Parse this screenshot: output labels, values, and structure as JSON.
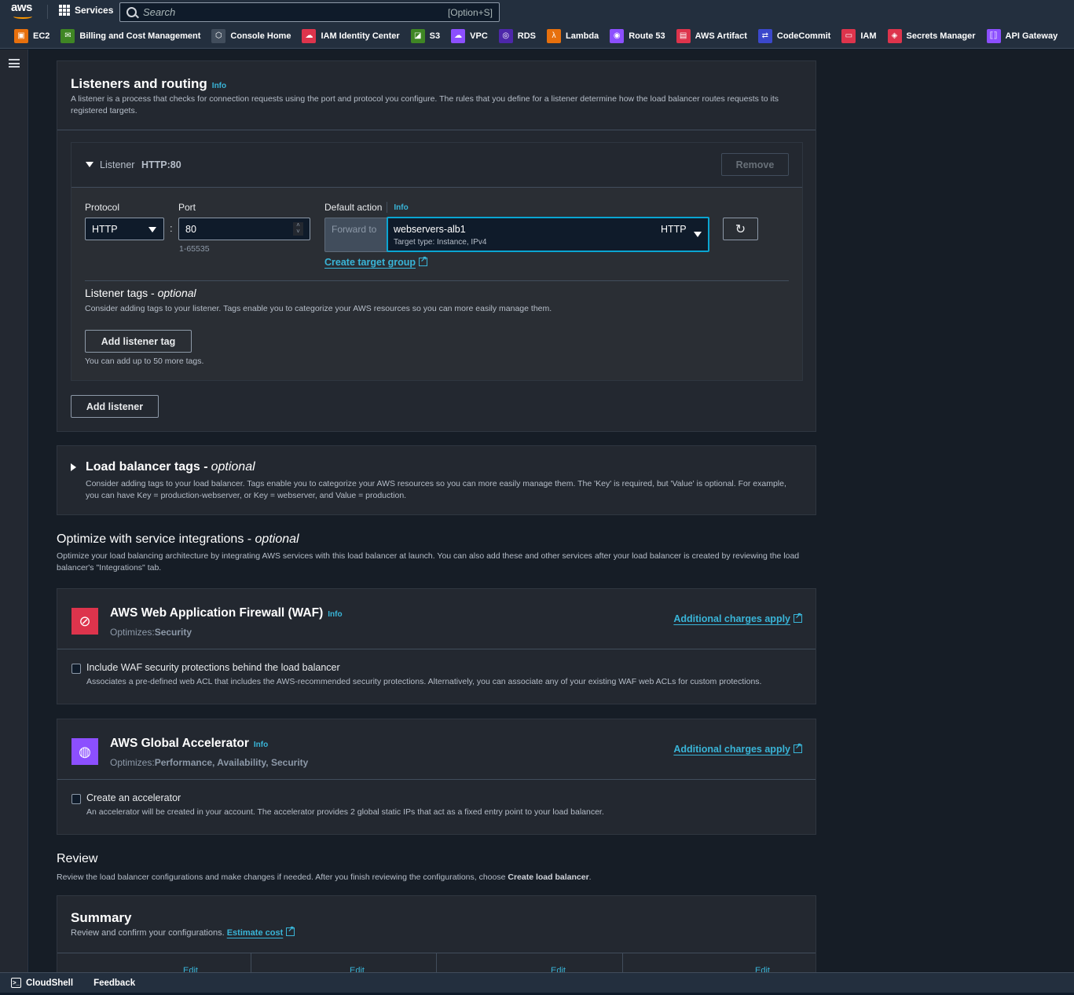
{
  "topbar": {
    "logo": "aws",
    "services_label": "Services",
    "search_placeholder": "Search",
    "search_shortcut": "[Option+S]"
  },
  "favorites": [
    {
      "label": "EC2",
      "icon": "ec2-icon",
      "color": "#e7700d"
    },
    {
      "label": "Billing and Cost Management",
      "icon": "billing-icon",
      "color": "#3f8624"
    },
    {
      "label": "Console Home",
      "icon": "cube-icon",
      "color": "#414d5c"
    },
    {
      "label": "IAM Identity Center",
      "icon": "identity-center-icon",
      "color": "#dd344c"
    },
    {
      "label": "S3",
      "icon": "s3-icon",
      "color": "#3f8624"
    },
    {
      "label": "VPC",
      "icon": "vpc-icon",
      "color": "#8c4fff"
    },
    {
      "label": "RDS",
      "icon": "rds-icon",
      "color": "#4d27aa"
    },
    {
      "label": "Lambda",
      "icon": "lambda-icon",
      "color": "#e7700d"
    },
    {
      "label": "Route 53",
      "icon": "route53-icon",
      "color": "#8c4fff"
    },
    {
      "label": "AWS Artifact",
      "icon": "artifact-icon",
      "color": "#dd344c"
    },
    {
      "label": "CodeCommit",
      "icon": "codecommit-icon",
      "color": "#3b48cc"
    },
    {
      "label": "IAM",
      "icon": "iam-icon",
      "color": "#dd344c"
    },
    {
      "label": "Secrets Manager",
      "icon": "secrets-manager-icon",
      "color": "#dd344c"
    },
    {
      "label": "API Gateway",
      "icon": "api-gateway-icon",
      "color": "#8c4fff"
    }
  ],
  "listeners": {
    "title": "Listeners and routing",
    "info": "Info",
    "description": "A listener is a process that checks for connection requests using the port and protocol you configure. The rules that you define for a listener determine how the load balancer routes requests to its registered targets.",
    "listener": {
      "label": "Listener",
      "name": "HTTP:80",
      "remove_label": "Remove",
      "protocol_label": "Protocol",
      "protocol_value": "HTTP",
      "port_label": "Port",
      "port_value": "80",
      "port_hint": "1-65535",
      "default_action_label": "Default action",
      "default_action_info": "Info",
      "forward_to": "Forward to",
      "target_group_name": "webservers-alb1",
      "target_group_protocol": "HTTP",
      "target_type": "Target type: Instance, IPv4",
      "create_target_group": "Create target group",
      "tags_title": "Listener tags - ",
      "tags_optional": "optional",
      "tags_description": "Consider adding tags to your listener. Tags enable you to categorize your AWS resources so you can more easily manage them.",
      "add_tag_label": "Add listener tag",
      "tags_hint": "You can add up to 50 more tags."
    },
    "add_listener_label": "Add listener"
  },
  "lb_tags": {
    "title": "Load balancer tags - ",
    "optional": "optional",
    "description": "Consider adding tags to your load balancer. Tags enable you to categorize your AWS resources so you can more easily manage them. The 'Key' is required, but 'Value' is optional. For example, you can have Key = production-webserver, or Key = webserver, and Value = production."
  },
  "integrations": {
    "title": "Optimize with service integrations - ",
    "optional": "optional",
    "description": "Optimize your load balancing architecture by integrating AWS services with this load balancer at launch. You can also add these and other services after your load balancer is created by reviewing the load balancer's \"Integrations\" tab.",
    "waf": {
      "title": "AWS Web Application Firewall (WAF)",
      "info": "Info",
      "optimizes_label": "Optimizes:",
      "optimizes_value": "Security",
      "charges_link": "Additional charges apply",
      "checkbox_label": "Include WAF security protections behind the load balancer",
      "checkbox_checked": false,
      "checkbox_description": "Associates a pre-defined web ACL that includes the AWS-recommended security protections. Alternatively, you can associate any of your existing WAF web ACLs for custom protections."
    },
    "accelerator": {
      "title": "AWS Global Accelerator",
      "info": "Info",
      "optimizes_label": "Optimizes:",
      "optimizes_value": "Performance, Availability, Security",
      "charges_link": "Additional charges apply",
      "checkbox_label": "Create an accelerator",
      "checkbox_checked": false,
      "checkbox_description": "An accelerator will be created in your account. The accelerator provides 2 global static IPs that act as a fixed entry point to your load balancer."
    }
  },
  "review": {
    "title": "Review",
    "description_prefix": "Review the load balancer configurations and make changes if needed. After you finish reviewing the configurations, choose ",
    "description_bold": "Create load balancer",
    "description_suffix": ".",
    "summary_title": "Summary",
    "summary_description": "Review and confirm your configurations.",
    "estimate_cost": "Estimate cost",
    "columns": [
      {
        "edit": "Edit"
      },
      {
        "edit": "Edit"
      },
      {
        "edit": "Edit"
      },
      {
        "edit": "Edit"
      }
    ]
  },
  "bottombar": {
    "cloudshell": "CloudShell",
    "feedback": "Feedback"
  }
}
